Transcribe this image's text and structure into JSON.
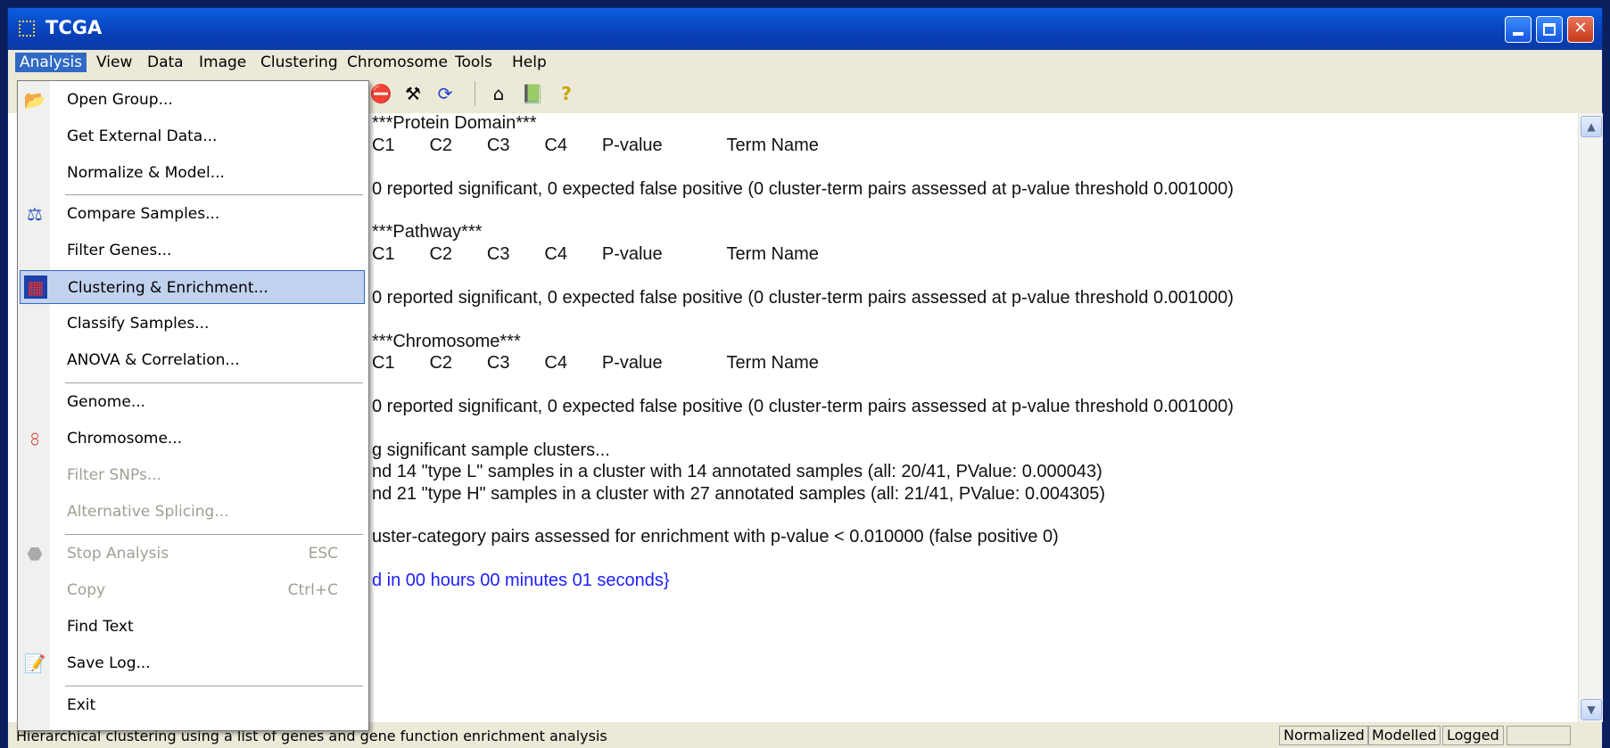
{
  "window": {
    "title": "TCGA"
  },
  "menubar": [
    "Analysis",
    "View",
    "Data",
    "Image",
    "Clustering",
    "Chromosome",
    "Tools",
    "Help"
  ],
  "analysis_menu": [
    {
      "label": "Open Group...",
      "icon": "open-folder-icon",
      "enabled": true
    },
    {
      "label": "Get External Data...",
      "enabled": true
    },
    {
      "label": "Normalize & Model...",
      "enabled": true
    },
    {
      "label": "Compare Samples...",
      "icon": "balance-scale-icon",
      "enabled": true
    },
    {
      "label": "Filter Genes...",
      "enabled": true
    },
    {
      "label": "Clustering  & Enrichment...",
      "icon": "clustering-icon",
      "enabled": true,
      "selected": true
    },
    {
      "label": "Classify Samples...",
      "enabled": true
    },
    {
      "label": "ANOVA & Correlation...",
      "enabled": true
    },
    {
      "label": "Genome...",
      "enabled": true
    },
    {
      "label": "Chromosome...",
      "icon": "chromosome-icon",
      "enabled": true
    },
    {
      "label": "Filter SNPs...",
      "enabled": false
    },
    {
      "label": "Alternative Splicing...",
      "enabled": false
    },
    {
      "label": "Stop Analysis",
      "shortcut": "ESC",
      "icon": "stop-icon",
      "enabled": false
    },
    {
      "label": "Copy",
      "shortcut": "Ctrl+C",
      "enabled": false
    },
    {
      "label": "Find Text",
      "enabled": true
    },
    {
      "label": "Save Log...",
      "icon": "save-log-icon",
      "enabled": true
    },
    {
      "label": "Exit",
      "enabled": true
    }
  ],
  "log_lines": [
    "***Protein Domain***",
    "C1       C2       C3       C4       P-value             Term Name",
    "0 reported significant, 0 expected false positive (0 cluster-term pairs assessed at p-value threshold 0.001000)",
    "***Pathway***",
    "C1       C2       C3       C4       P-value             Term Name",
    "0 reported significant, 0 expected false positive (0 cluster-term pairs assessed at p-value threshold 0.001000)",
    "***Chromosome***",
    "C1       C2       C3       C4       P-value             Term Name",
    "0 reported significant, 0 expected false positive (0 cluster-term pairs assessed at p-value threshold 0.001000)",
    "g significant sample clusters...",
    "nd 14 \"type L\" samples in a cluster with 14 annotated samples (all: 20/41, PValue: 0.000043)",
    "nd 21 \"type H\" samples in a cluster with 27 annotated samples (all: 21/41, PValue: 0.004305)",
    "uster-category pairs assessed for enrichment with p-value < 0.010000 (false positive 0)",
    "d in 00 hours 00 minutes 01 seconds}"
  ],
  "status": {
    "text": "Hierarchical clustering using a list of genes and gene function enrichment analysis",
    "panels": [
      "Normalized",
      "Modelled",
      "Logged",
      ""
    ]
  },
  "colors": {
    "titlebar": "#0a5fe0",
    "menu_highlight": "#316ac5",
    "selected_item": "#c1d2ee",
    "log_link": "#1e1eff"
  }
}
